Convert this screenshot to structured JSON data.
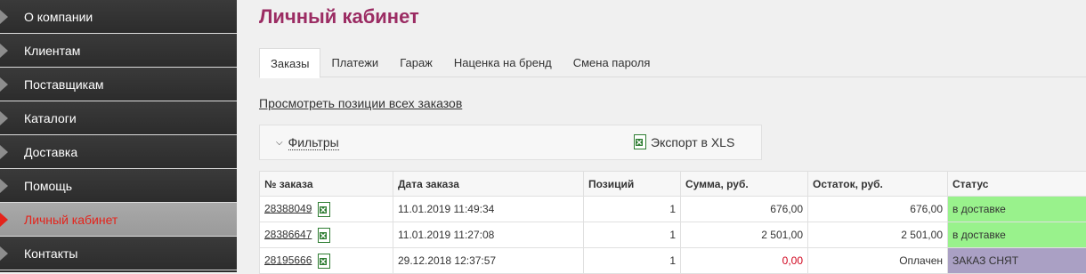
{
  "sidebar": {
    "items": [
      {
        "label": "О компании"
      },
      {
        "label": "Клиентам"
      },
      {
        "label": "Поставщикам"
      },
      {
        "label": "Каталоги"
      },
      {
        "label": "Доставка"
      },
      {
        "label": "Помощь"
      },
      {
        "label": "Личный кабинет"
      },
      {
        "label": "Контакты"
      }
    ],
    "active_index": 6
  },
  "page": {
    "title": "Личный кабинет"
  },
  "tabs": [
    {
      "label": "Заказы"
    },
    {
      "label": "Платежи"
    },
    {
      "label": "Гараж"
    },
    {
      "label": "Наценка на бренд"
    },
    {
      "label": "Смена пароля"
    }
  ],
  "all_orders_link": "Просмотреть позиции всех заказов",
  "filters": {
    "toggle_label": "Фильтры",
    "export_label": "Экспорт в XLS"
  },
  "table": {
    "headers": [
      "№ заказа",
      "Дата заказа",
      "Позиций",
      "Сумма, руб.",
      "Остаток, руб.",
      "Статус"
    ],
    "rows": [
      {
        "order": "28388049",
        "date": "11.01.2019 11:49:34",
        "positions": "1",
        "sum": "676,00",
        "balance": "676,00",
        "status": "в доставке"
      },
      {
        "order": "28386647",
        "date": "11.01.2019 11:27:08",
        "positions": "1",
        "sum": "2 501,00",
        "balance": "2 501,00",
        "status": "в доставке"
      },
      {
        "order": "28195666",
        "date": "29.12.2018 12:37:57",
        "positions": "1",
        "sum": "0,00",
        "balance": "Оплачен",
        "status": "ЗАКАЗ СНЯТ"
      }
    ]
  },
  "colors": {
    "title": "#9b2c63",
    "active_sidebar": "#e4231b",
    "status_delivery": "#99f28c",
    "status_cancel": "#aaa0c4",
    "negative_sum": "#d0021b"
  }
}
